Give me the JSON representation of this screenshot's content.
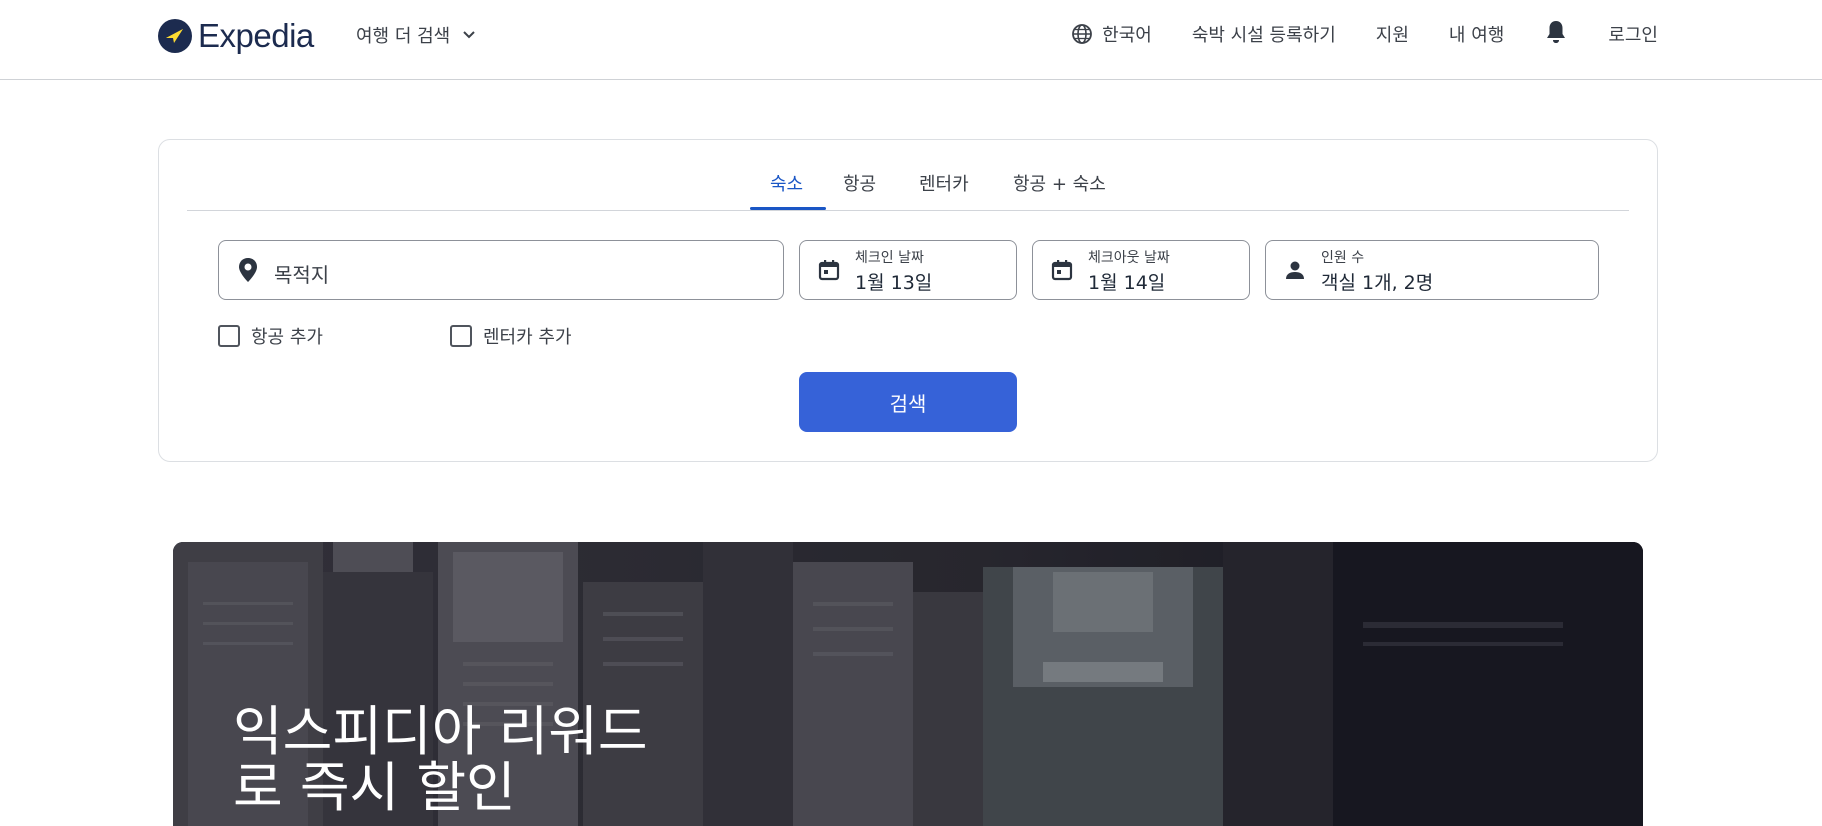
{
  "header": {
    "logo_text": "Expedia",
    "more_travel": "여행 더 검색",
    "nav": {
      "language": "한국어",
      "list_property": "숙박 시설 등록하기",
      "support": "지원",
      "my_trips": "내 여행",
      "login": "로그인"
    },
    "icons": {
      "logo": "expedia-plane-icon",
      "dropdown": "chevron-down-icon",
      "language": "globe-icon",
      "notifications": "bell-icon"
    }
  },
  "search": {
    "tabs": [
      {
        "label": "숙소",
        "active": true
      },
      {
        "label": "항공",
        "active": false
      },
      {
        "label": "렌터카",
        "active": false
      },
      {
        "label": "항공 + 숙소",
        "active": false
      }
    ],
    "destination": {
      "placeholder": "목적지",
      "icon": "map-pin-icon"
    },
    "checkin": {
      "label": "체크인 날짜",
      "value": "1월 13일",
      "icon": "calendar-icon"
    },
    "checkout": {
      "label": "체크아웃 날짜",
      "value": "1월 14일",
      "icon": "calendar-icon"
    },
    "travelers": {
      "label": "인원 수",
      "value": "객실 1개, 2명",
      "icon": "person-icon"
    },
    "add_flight": {
      "label": "항공 추가",
      "checked": false
    },
    "add_car": {
      "label": "렌터카 추가",
      "checked": false
    },
    "search_button": "검색"
  },
  "hero": {
    "title_line1": "익스피디아 리워드",
    "title_line2": "로 즉시 할인"
  },
  "colors": {
    "brand_navy": "#1c2b4f",
    "brand_yellow": "#fddb32",
    "accent_blue": "#1a56c5",
    "button_blue": "#3662d8"
  }
}
